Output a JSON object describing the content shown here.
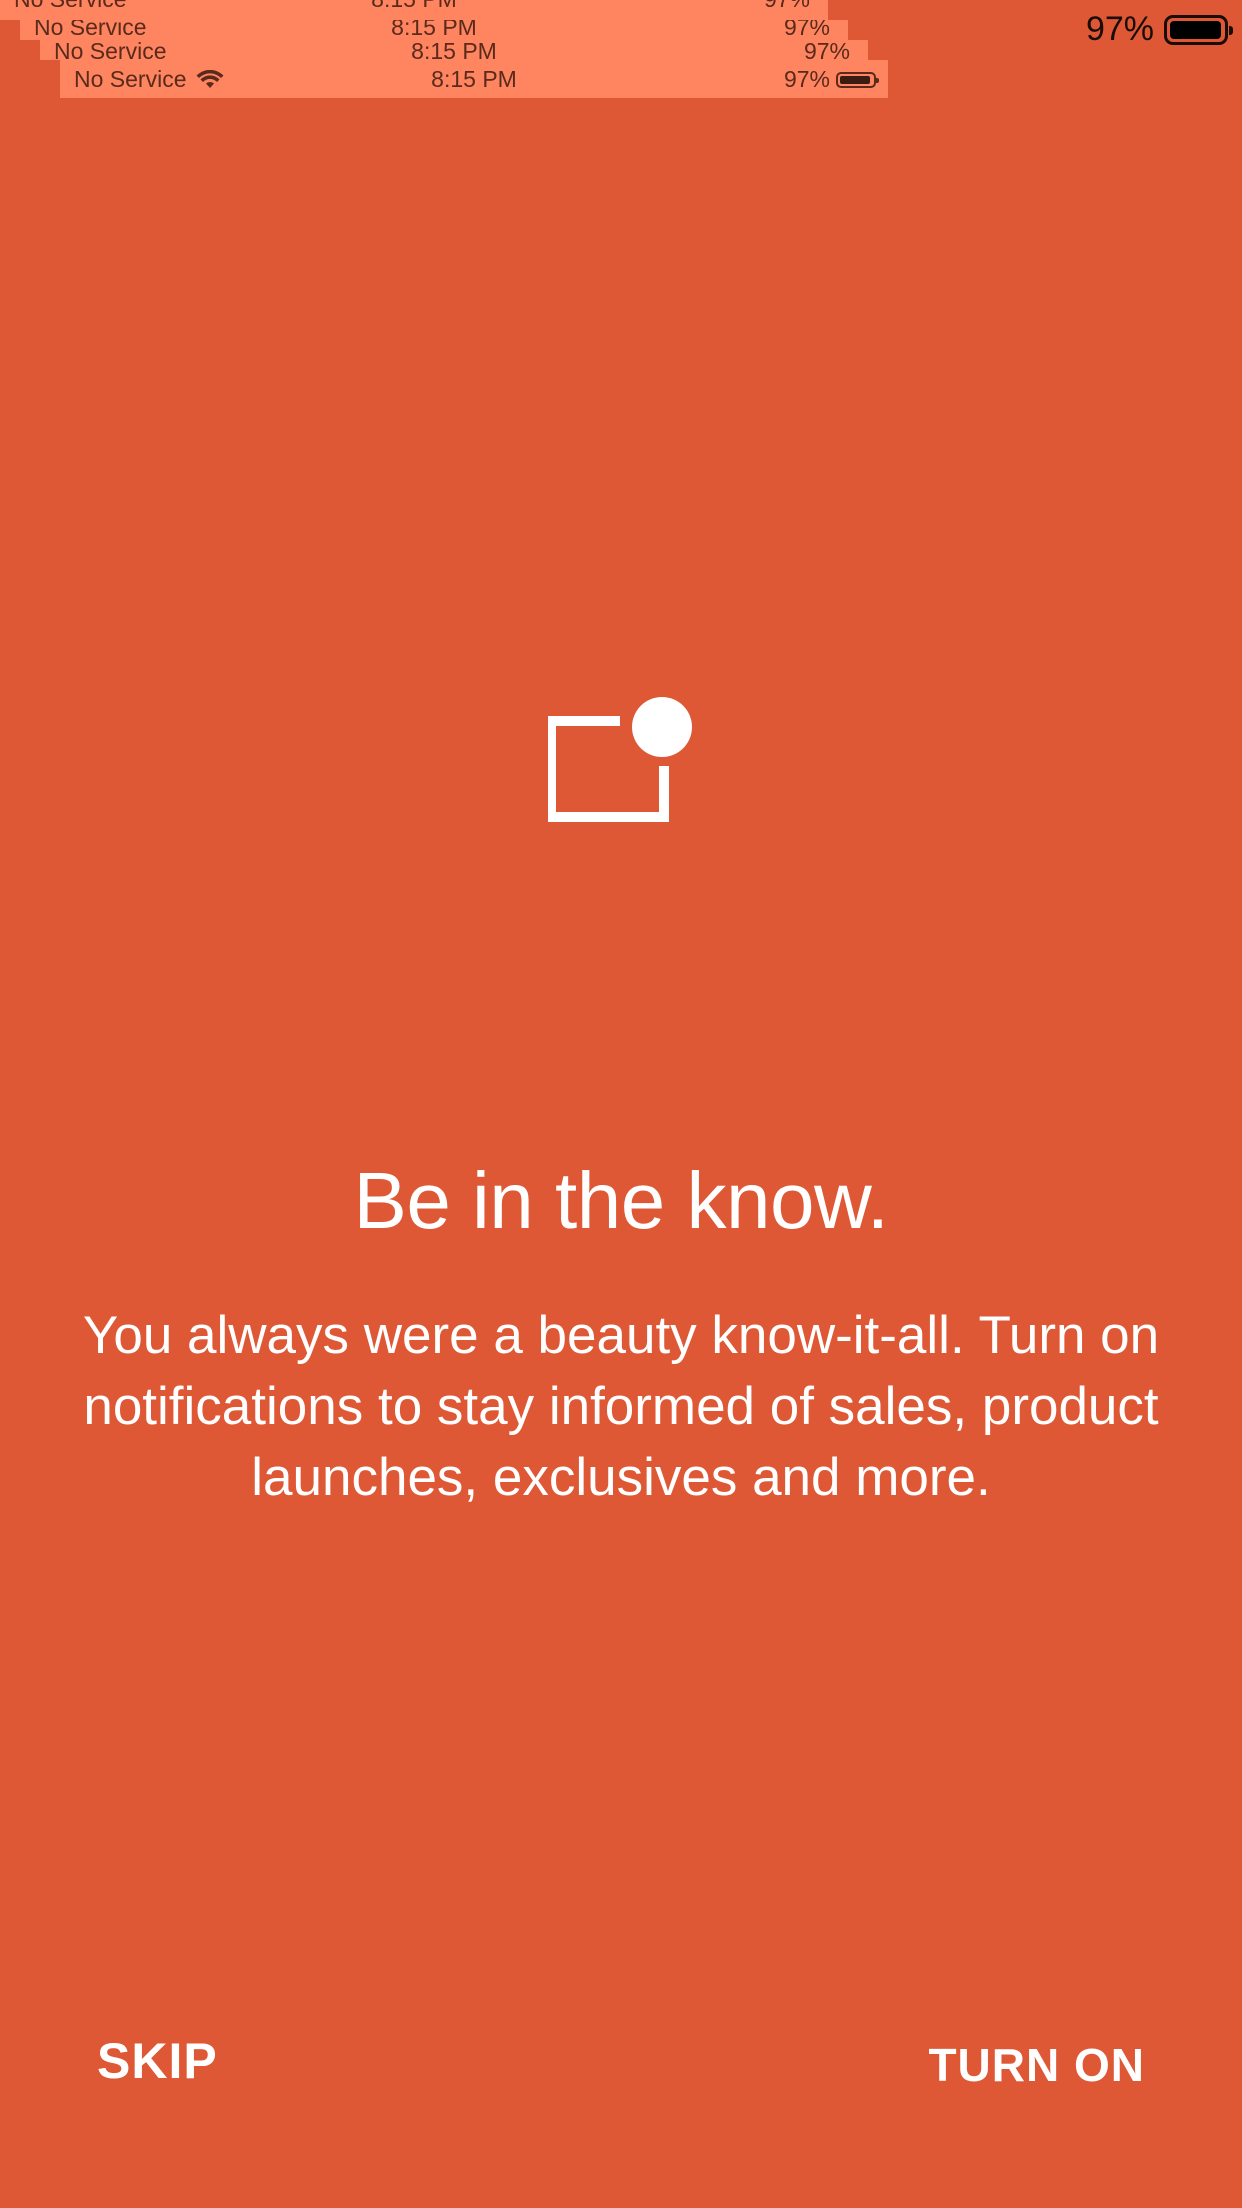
{
  "status_bar": {
    "carrier": "No Service",
    "time": "8:15 PM",
    "battery": "97%",
    "wifi_icon": "wifi-icon",
    "battery_icon": "battery-icon"
  },
  "icon": {
    "name": "notification-badge-icon",
    "color": "#FFFFFF"
  },
  "main": {
    "title": "Be in the know.",
    "body": "You always were a beauty know-it-all. Turn on notifications to stay informed of sales, product launches, exclusives and more."
  },
  "actions": {
    "skip_label": "SKIP",
    "turn_on_label": "TURN ON"
  },
  "colors": {
    "background": "#DE5835",
    "overlay": "#FF8460",
    "text": "#FFFFFF"
  }
}
